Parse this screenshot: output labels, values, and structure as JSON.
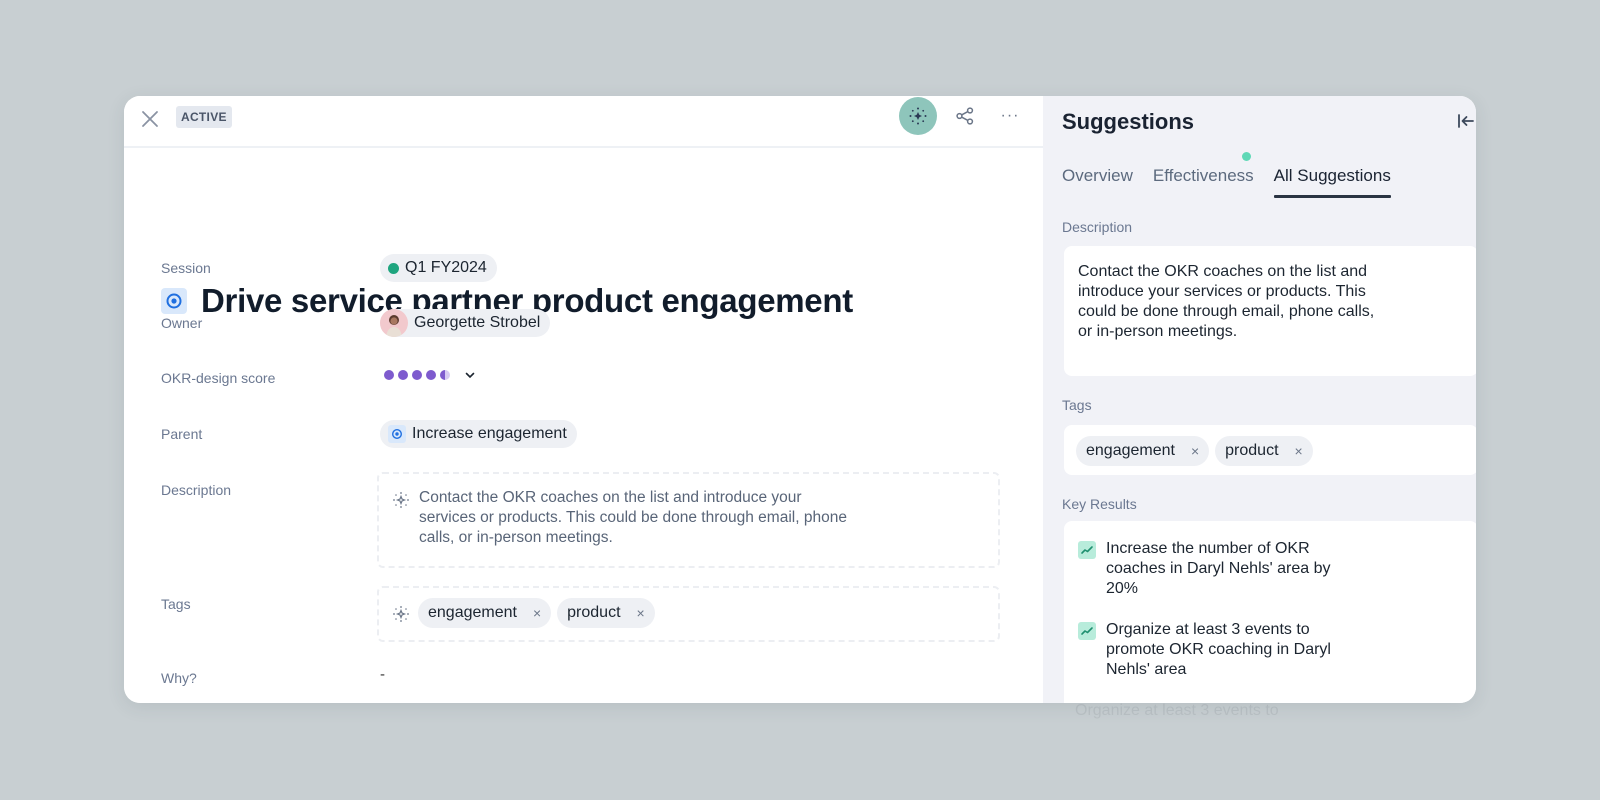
{
  "header": {
    "status_badge": "ACTIVE",
    "close_icon": "close-icon",
    "actions": [
      {
        "name": "ai-suggestions",
        "icon": "sparkle-icon",
        "active": true,
        "color": "#8ec5bb"
      },
      {
        "name": "share",
        "icon": "share-icon"
      },
      {
        "name": "more",
        "icon": "more-horizontal-icon",
        "glyph": "···"
      }
    ]
  },
  "objective": {
    "title": "Drive service partner product engagement",
    "icon": "objective-target-icon",
    "fields": {
      "session": {
        "label": "Session",
        "value": "Q1 FY2024",
        "status_color": "#1fa57f"
      },
      "owner": {
        "label": "Owner",
        "value": "Georgette Strobel"
      },
      "okr_design_score": {
        "label": "OKR-design score",
        "score": 4.5,
        "max": 5,
        "color": "#7e5bce"
      },
      "parent": {
        "label": "Parent",
        "value": "Increase engagement"
      },
      "description": {
        "label": "Description",
        "value": "Contact the OKR coaches on the list and introduce your services or products. This could be done through email, phone calls, or in-person meetings."
      },
      "tags": {
        "label": "Tags",
        "items": [
          "engagement",
          "product"
        ],
        "remove_glyph": "×"
      },
      "why": {
        "label": "Why?",
        "value": "-"
      }
    }
  },
  "suggestions": {
    "title": "Suggestions",
    "collapse_icon": "collapse-panel-icon",
    "tabs": [
      {
        "label": "Overview",
        "active": false
      },
      {
        "label": "Effectiveness",
        "active": false,
        "has_notification": true
      },
      {
        "label": "All Suggestions",
        "active": true
      }
    ],
    "description": {
      "label": "Description",
      "value": "Contact the OKR coaches on the list and introduce your services or products. This could be done through email, phone calls, or in-person meetings."
    },
    "tags": {
      "label": "Tags",
      "items": [
        "engagement",
        "product"
      ]
    },
    "key_results": {
      "label": "Key Results",
      "items": [
        "Increase the number of OKR coaches in Daryl Nehls' area by 20%",
        "Organize at least 3 events to promote OKR coaching in Daryl Nehls' area",
        "Organize at least 3 events to"
      ]
    }
  }
}
